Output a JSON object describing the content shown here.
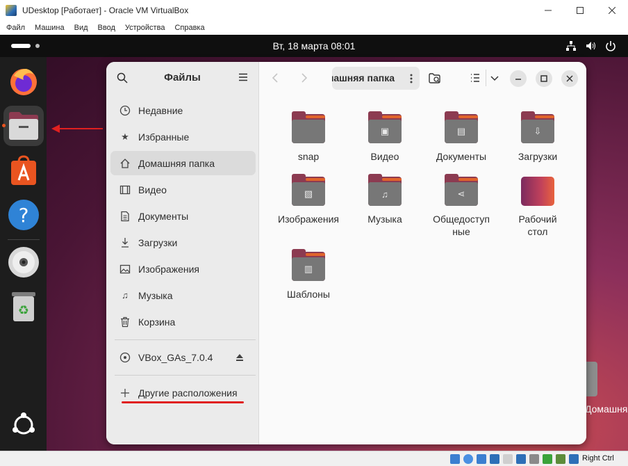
{
  "vbox": {
    "title": "UDesktop [Работает] - Oracle VM VirtualBox",
    "menu": [
      "Файл",
      "Машина",
      "Вид",
      "Ввод",
      "Устройства",
      "Справка"
    ],
    "window_controls": {
      "minimize": "—",
      "maximize": "☐",
      "close": "✕"
    },
    "host_key": "Right Ctrl"
  },
  "topbar": {
    "clock": "Вт, 18 марта  08:01",
    "icons": [
      "network-icon",
      "volume-icon",
      "power-icon"
    ]
  },
  "dock": {
    "items": [
      "firefox",
      "files",
      "app-center",
      "help",
      "optical-disc",
      "trash"
    ],
    "active": "files"
  },
  "files": {
    "sidebar_title": "Файлы",
    "sidebar": [
      {
        "label": "Недавние",
        "icon": "clock-icon"
      },
      {
        "label": "Избранные",
        "icon": "star-icon"
      },
      {
        "label": "Домашняя папка",
        "icon": "home-icon",
        "active": true
      },
      {
        "label": "Видео",
        "icon": "video-icon"
      },
      {
        "label": "Документы",
        "icon": "document-icon"
      },
      {
        "label": "Загрузки",
        "icon": "download-icon"
      },
      {
        "label": "Изображения",
        "icon": "image-icon"
      },
      {
        "label": "Музыка",
        "icon": "music-icon"
      },
      {
        "label": "Корзина",
        "icon": "trash-icon"
      }
    ],
    "device": {
      "label": "VBox_GAs_7.0.4",
      "icon": "disc-icon"
    },
    "other_locations": "Другие расположения",
    "path_label": "Домашняя папка",
    "folders": [
      {
        "label": "snap",
        "icon": ""
      },
      {
        "label": "Видео",
        "icon": "▣"
      },
      {
        "label": "Документы",
        "icon": "▤"
      },
      {
        "label": "Загрузки",
        "icon": "⇩"
      },
      {
        "label": "Изображения",
        "icon": "▧"
      },
      {
        "label": "Музыка",
        "icon": "♫"
      },
      {
        "label": "Общедоступные",
        "icon": "⋖"
      },
      {
        "label": "Рабочий стол",
        "icon": ""
      },
      {
        "label": "Шаблоны",
        "icon": "▥"
      }
    ]
  },
  "desktop": {
    "folder_label": "Домашняя папка"
  },
  "colors": {
    "annotation": "#e02020",
    "accent": "#e95420",
    "folder": "#777777",
    "folder_back": "#8c3b51"
  }
}
